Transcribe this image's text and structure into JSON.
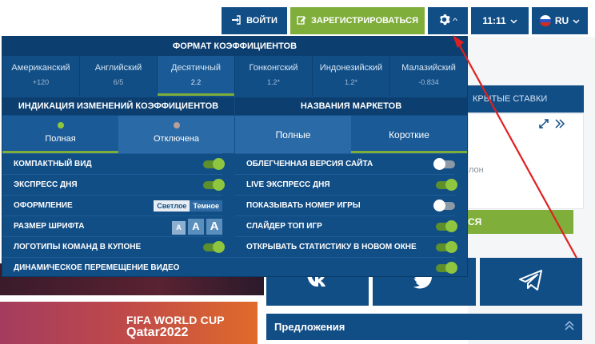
{
  "header": {
    "login_label": "ВОЙТИ",
    "register_label": "ЗАРЕГИСТРИРОВАТЬСЯ",
    "time": "11:11",
    "language": "RU"
  },
  "background": {
    "open_bets": "КРЫТЫЕ СТАВКИ",
    "field_text": "лон",
    "green_button": "СЯ",
    "offers": "Предложения",
    "banner_line1": "FIFA WORLD CUP",
    "banner_line2": "Qatar2022"
  },
  "settings": {
    "odds_title": "ФОРМАТ КОЭФФИЦИЕНТОВ",
    "odds_formats": [
      {
        "name": "Американский",
        "example": "+120"
      },
      {
        "name": "Английский",
        "example": "6/5"
      },
      {
        "name": "Десятичный",
        "example": "2.2"
      },
      {
        "name": "Гонконгский",
        "example": "1.2*"
      },
      {
        "name": "Индонезийский",
        "example": "1.2*"
      },
      {
        "name": "Малазийский",
        "example": "-0.834"
      }
    ],
    "indication_title": "ИНДИКАЦИЯ ИЗМЕНЕНИЙ КОЭФФИЦИЕНТОВ",
    "indication_full": "Полная",
    "indication_off": "Отключена",
    "markets_title": "НАЗВАНИЯ МАРКЕТОВ",
    "markets_full": "Полные",
    "markets_short": "Короткие",
    "left_options": {
      "compact": "КОМПАКТНЫЙ ВИД",
      "express": "ЭКСПРЕСС ДНЯ",
      "theme": "ОФОРМЛЕНИЕ",
      "theme_light": "Светлое",
      "theme_dark": "Темное",
      "font_size": "РАЗМЕР ШРИФТА",
      "font_a": "A",
      "logos": "ЛОГОТИПЫ КОМАНД В КУПОНЕ",
      "video": "ДИНАМИЧЕСКОЕ ПЕРЕМЕЩЕНИЕ ВИДЕО"
    },
    "right_options": {
      "lite": "ОБЛЕГЧЕННАЯ ВЕРСИЯ САЙТА",
      "live_express": "LIVE ЭКСПРЕСС ДНЯ",
      "game_number": "ПОКАЗЫВАТЬ НОМЕР ИГРЫ",
      "top_slider": "СЛАЙДЕР ТОП ИГР",
      "stats_window": "ОТКРЫВАТЬ СТАТИСТИКУ В НОВОМ ОКНЕ"
    }
  },
  "colors": {
    "brand_blue": "#124e86",
    "accent_green": "#7fae3b",
    "annotation_red": "#e02020"
  }
}
